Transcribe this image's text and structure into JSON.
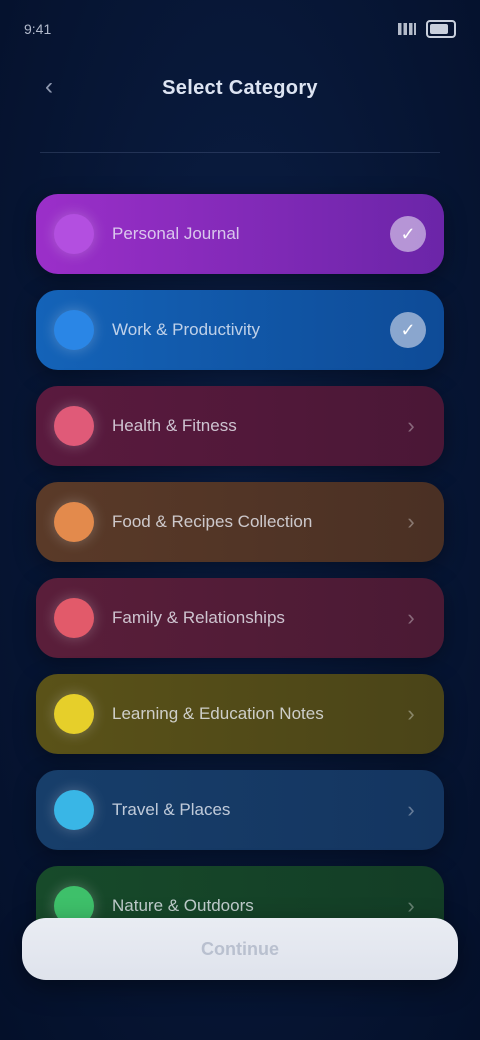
{
  "status_bar": {
    "time": "9:41"
  },
  "header": {
    "back_icon": "chevron-left-icon",
    "title": "Select Category"
  },
  "items": [
    {
      "label": "Personal Journal",
      "color_from": "#9b2fc9",
      "color_to": "#6b25a8",
      "dot": "#b34fe0",
      "trailing": "badge"
    },
    {
      "label": "Work & Productivity",
      "color_from": "#1463b8",
      "color_to": "#0e4b97",
      "dot": "#2a86e6",
      "trailing": "badge"
    },
    {
      "label": "Health & Fitness",
      "color_from": "#5a1a3e",
      "color_to": "#4a1736",
      "dot": "#e05a78",
      "trailing": "chevron"
    },
    {
      "label": "Food & Recipes Collection",
      "color_from": "#5a3a28",
      "color_to": "#4a3024",
      "dot": "#e38a4c",
      "trailing": "chevron"
    },
    {
      "label": "Family & Relationships",
      "color_from": "#5a1e3a",
      "color_to": "#4a1a34",
      "dot": "#e25a6a",
      "trailing": "chevron"
    },
    {
      "label": "Learning & Education Notes",
      "color_from": "#5a5218",
      "color_to": "#4a4418",
      "dot": "#e6cf2a",
      "trailing": "chevron"
    },
    {
      "label": "Travel & Places",
      "color_from": "#173e6a",
      "color_to": "#143560",
      "dot": "#39b6e6",
      "trailing": "chevron"
    },
    {
      "label": "Nature & Outdoors",
      "color_from": "#174a2a",
      "color_to": "#133d26",
      "dot": "#3ec06a",
      "trailing": "chevron"
    }
  ],
  "footer": {
    "button_label": "Continue"
  }
}
